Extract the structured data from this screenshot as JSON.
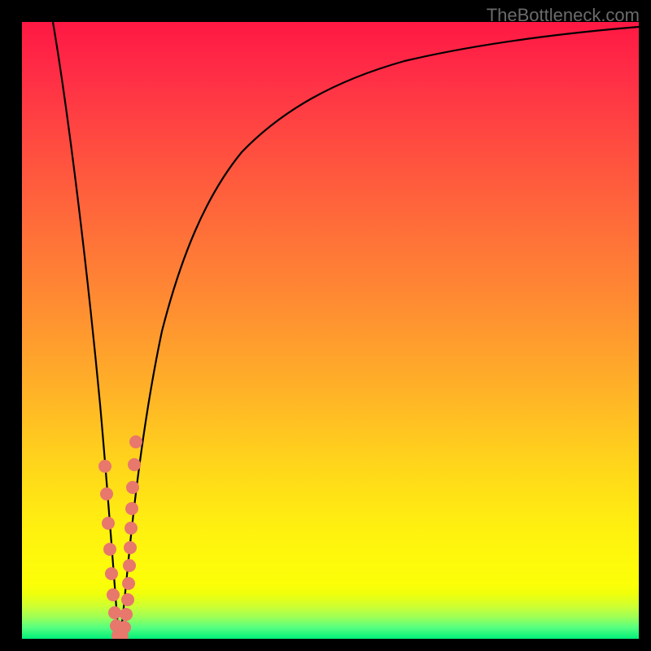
{
  "watermark": "TheBottleneck.com",
  "colors": {
    "frame": "#000000",
    "curve": "#000000",
    "dots": "#e8776c",
    "gradient_top": "#ff1844",
    "gradient_mid": "#ffe010",
    "gradient_bottom": "#00ef7a"
  },
  "chart_data": {
    "type": "line",
    "title": "",
    "xlabel": "",
    "ylabel": "",
    "xlim": [
      0,
      100
    ],
    "ylim": [
      0,
      100
    ],
    "series": [
      {
        "name": "bottleneck-curve",
        "x": [
          5,
          8,
          10,
          12,
          13,
          14,
          15,
          15.5,
          16,
          16.5,
          17,
          18,
          20,
          23,
          27,
          32,
          38,
          45,
          55,
          70,
          85,
          100
        ],
        "y": [
          100,
          75,
          55,
          35,
          22,
          12,
          4,
          0,
          3,
          10,
          18,
          30,
          45,
          58,
          68,
          75,
          80,
          84,
          87.5,
          90.5,
          92.5,
          93.5
        ]
      }
    ],
    "points": [
      {
        "name": "dots-left",
        "x_approx": 14.5,
        "y_range_pct": [
          0,
          28
        ],
        "count": 9
      },
      {
        "name": "dots-right",
        "x_approx": 17.5,
        "y_range_pct": [
          0,
          32
        ],
        "count": 12
      }
    ],
    "note": "x and y are percentages of the plot area; y measured from bottom. Curve minimum ≈ x=15.5. Dot clusters run vertically along each branch near the bottom."
  }
}
